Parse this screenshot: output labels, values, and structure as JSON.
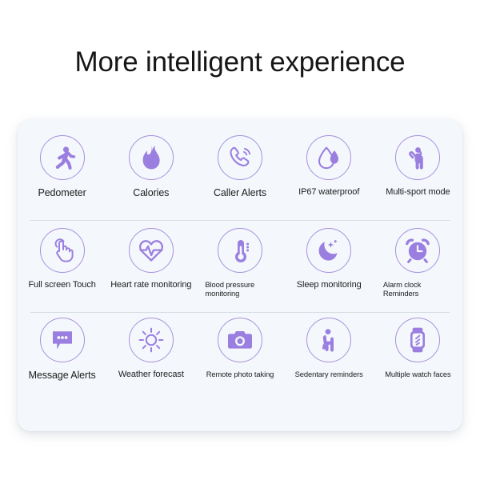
{
  "page": {
    "title": "More intelligent experience",
    "background_color": "#ffffff",
    "card_background_color": "#f4f8fc",
    "accent_color": "#9b7fe0",
    "circle_border_color": "#a98fdd",
    "divider_color": "#d7dce2",
    "text_color": "#1c1c1c"
  },
  "features": {
    "rows": [
      {
        "row_index": 1,
        "items": [
          {
            "id": "pedometer",
            "label": "Pedometer",
            "icon": "running-person-icon",
            "size": "normal"
          },
          {
            "id": "calories",
            "label": "Calories",
            "icon": "flame-icon",
            "size": "normal"
          },
          {
            "id": "caller-alerts",
            "label": "Caller Alerts",
            "icon": "phone-call-icon",
            "size": "normal"
          },
          {
            "id": "ip67-waterproof",
            "label": "IP67 waterproof",
            "icon": "water-drop-icon",
            "size": "mid"
          },
          {
            "id": "multi-sport-mode",
            "label": "Multi-sport mode",
            "icon": "stretching-person-icon",
            "size": "mid"
          }
        ]
      },
      {
        "row_index": 2,
        "items": [
          {
            "id": "full-screen-touch",
            "label": "Full screen Touch",
            "icon": "hand-tap-icon",
            "size": "mid"
          },
          {
            "id": "heart-rate-monitoring",
            "label": "Heart rate monitoring",
            "icon": "heart-pulse-icon",
            "size": "mid"
          },
          {
            "id": "blood-pressure-monitoring",
            "label": "Blood pressure\nmonitoring",
            "icon": "thermometer-icon",
            "size": "small-left"
          },
          {
            "id": "sleep-monitoring",
            "label": "Sleep monitoring",
            "icon": "moon-stars-icon",
            "size": "mid"
          },
          {
            "id": "alarm-clock-reminders",
            "label": "Alarm clock\nReminders",
            "icon": "alarm-clock-icon",
            "size": "small-left"
          }
        ]
      },
      {
        "row_index": 3,
        "items": [
          {
            "id": "message-alerts",
            "label": "Message Alerts",
            "icon": "chat-bubble-icon",
            "size": "normal"
          },
          {
            "id": "weather-forecast",
            "label": "Weather forecast",
            "icon": "sun-icon",
            "size": "mid"
          },
          {
            "id": "remote-photo-taking",
            "label": "Remote photo taking",
            "icon": "camera-icon",
            "size": "small"
          },
          {
            "id": "sedentary-reminders",
            "label": "Sedentary reminders",
            "icon": "sitting-person-icon",
            "size": "small"
          },
          {
            "id": "multiple-watch-faces",
            "label": "Multiple watch faces",
            "icon": "smartwatch-icon",
            "size": "small"
          }
        ]
      }
    ]
  }
}
